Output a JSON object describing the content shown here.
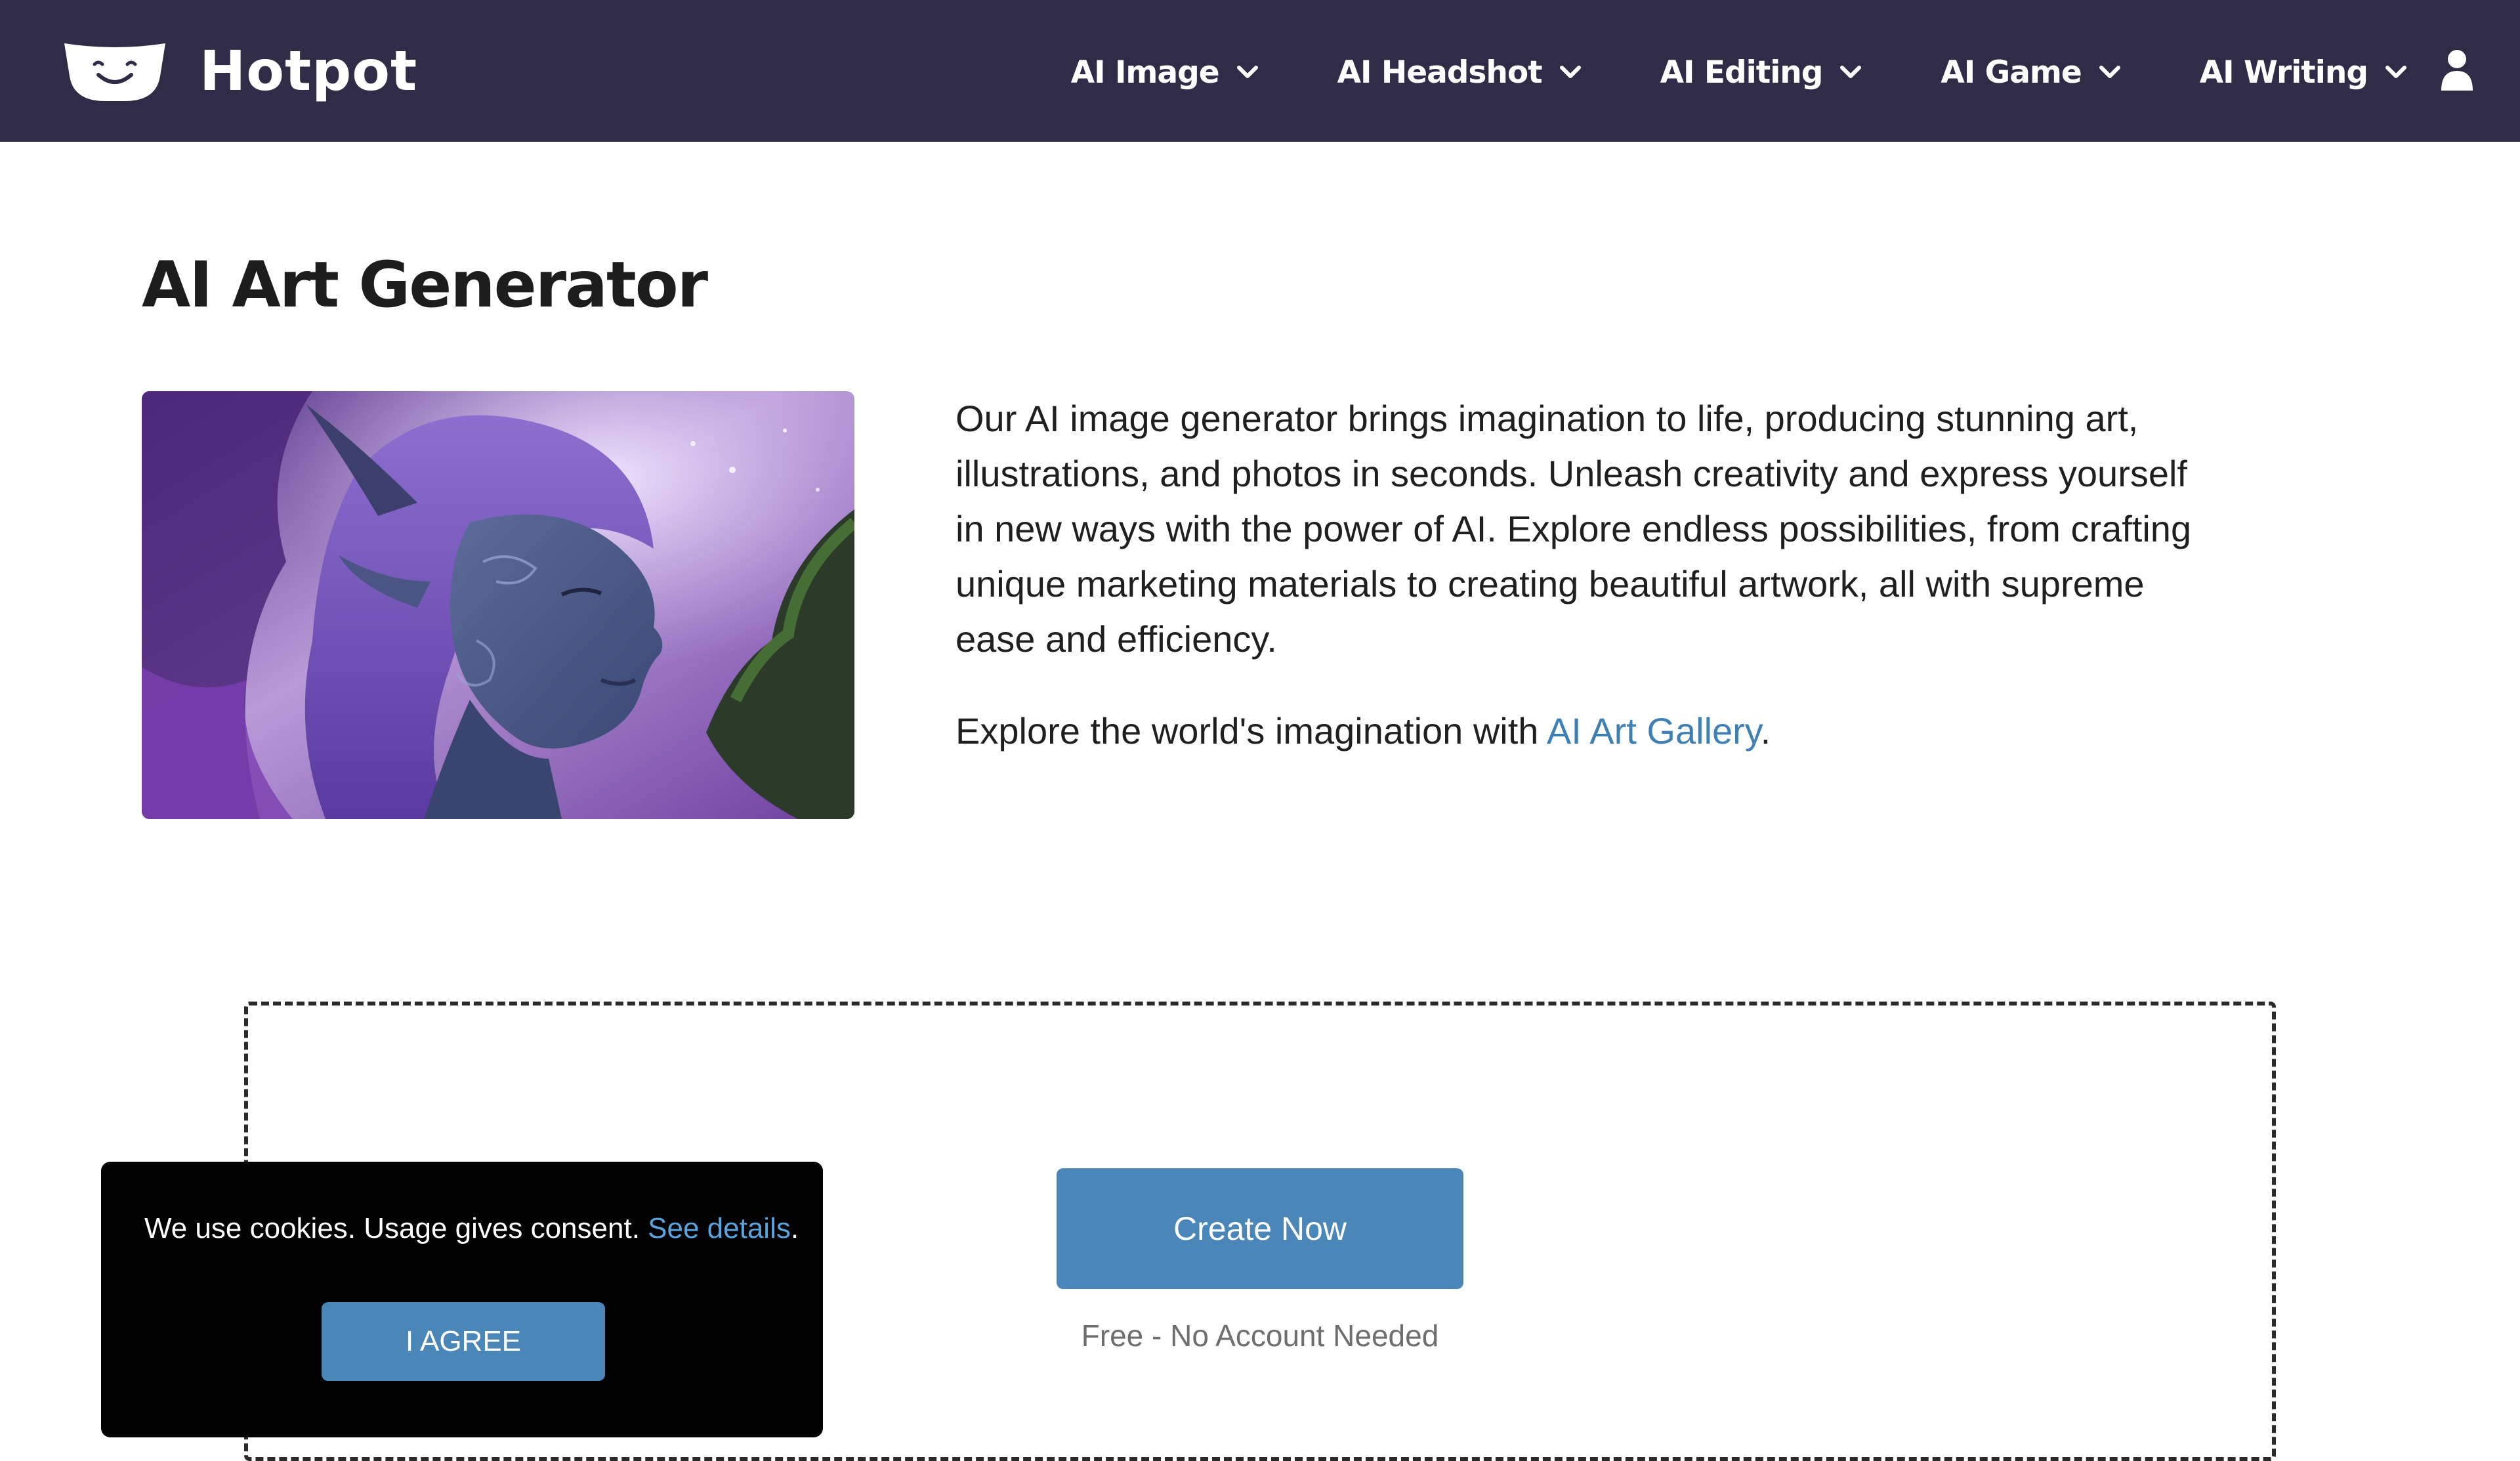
{
  "header": {
    "brand": "Hotpot",
    "logo_icon": "hotpot-logo-icon",
    "nav": [
      {
        "label": "AI Image",
        "icon": "chevron-down-icon"
      },
      {
        "label": "AI Headshot",
        "icon": "chevron-down-icon"
      },
      {
        "label": "AI Editing",
        "icon": "chevron-down-icon"
      },
      {
        "label": "AI Game",
        "icon": "chevron-down-icon"
      },
      {
        "label": "AI Writing",
        "icon": "chevron-down-icon"
      }
    ],
    "user_icon": "user-icon"
  },
  "main": {
    "title": "AI Art Generator",
    "image_icon": "fantasy-elf-artwork",
    "description": "Our AI image generator brings imagination to life, producing stunning art, illustrations, and photos in seconds. Unleash creativity and express yourself in new ways with the power of AI. Explore endless possibilities, from crafting unique marketing materials to creating beautiful artwork, all with supreme ease and efficiency.",
    "gallery_prefix": "Explore the world's imagination with ",
    "gallery_link": "AI Art Gallery",
    "gallery_suffix": "."
  },
  "create": {
    "button_label": "Create Now",
    "subtext": "Free - No Account Needed"
  },
  "cookie_banner": {
    "text": "We use cookies. Usage gives consent. ",
    "link": "See details",
    "suffix": ".",
    "agree_label": "I AGREE"
  },
  "colors": {
    "header_bg": "#302b47",
    "accent_blue": "#4a86b8",
    "link_blue": "#3f7fb3",
    "cookie_link_blue": "#5ba3dc"
  }
}
